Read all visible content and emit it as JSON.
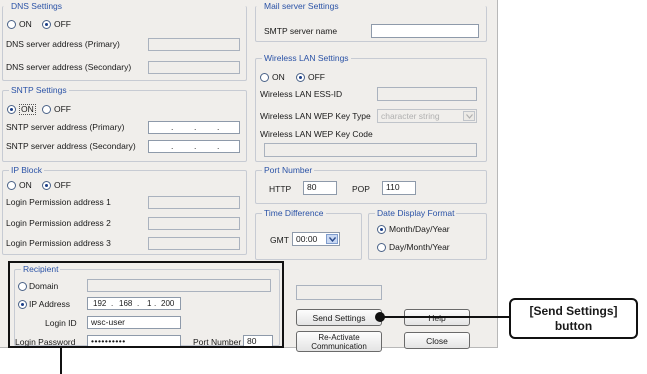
{
  "dns": {
    "title": "DNS Settings",
    "on": "ON",
    "off": "OFF",
    "primary": "DNS server address (Primary)",
    "secondary": "DNS server address (Secondary)",
    "selected": "off"
  },
  "sntp": {
    "title": "SNTP Settings",
    "on": "ON",
    "off": "OFF",
    "primary": "SNTP server address (Primary)",
    "secondary": "SNTP server address (Secondary)",
    "dot": ".",
    "selected": "on"
  },
  "ipblock": {
    "title": "IP Block",
    "on": "ON",
    "off": "OFF",
    "addr1": "Login Permission address 1",
    "addr2": "Login Permission address 2",
    "addr3": "Login Permission address 3",
    "selected": "off"
  },
  "recipient": {
    "title": "Recipient",
    "domain": "Domain",
    "ip_label": "IP Address",
    "ip": [
      "192",
      "168",
      "1",
      "200"
    ],
    "dot": ".",
    "login_id_label": "Login ID",
    "login_id": "wsc-user",
    "password_label": "Login Password",
    "password": "••••••••••",
    "port_label": "Port Number",
    "port": "80",
    "selected": "ip"
  },
  "mail": {
    "title": "Mail server Settings",
    "smtp_label": "SMTP server name",
    "smtp": ""
  },
  "wlan": {
    "title": "Wireless LAN Settings",
    "on": "ON",
    "off": "OFF",
    "essid": "Wireless LAN ESS-ID",
    "wep_type": "Wireless LAN WEP Key Type",
    "wep_type_value": "character string",
    "wep_code": "Wireless LAN WEP Key Code",
    "selected": "off"
  },
  "port": {
    "title": "Port Number",
    "http_label": "HTTP",
    "http": "80",
    "pop_label": "POP",
    "pop": "110"
  },
  "timediff": {
    "title": "Time Difference",
    "gmt_label": "GMT",
    "gmt_value": "00:00"
  },
  "datefmt": {
    "title": "Date Display Format",
    "opt1": "Month/Day/Year",
    "opt2": "Day/Month/Year",
    "selected": "opt1"
  },
  "buttons": {
    "send": "Send Settings",
    "help": "Help",
    "reactivate_1": "Re-Activate",
    "reactivate_2": "Communication",
    "close": "Close"
  },
  "callout": {
    "line1": "[Send Settings]",
    "line2": "button"
  },
  "colors": {
    "group_title": "#2a52a6",
    "dialog_bg": "#f0eeeb",
    "highlight": "#111111"
  }
}
